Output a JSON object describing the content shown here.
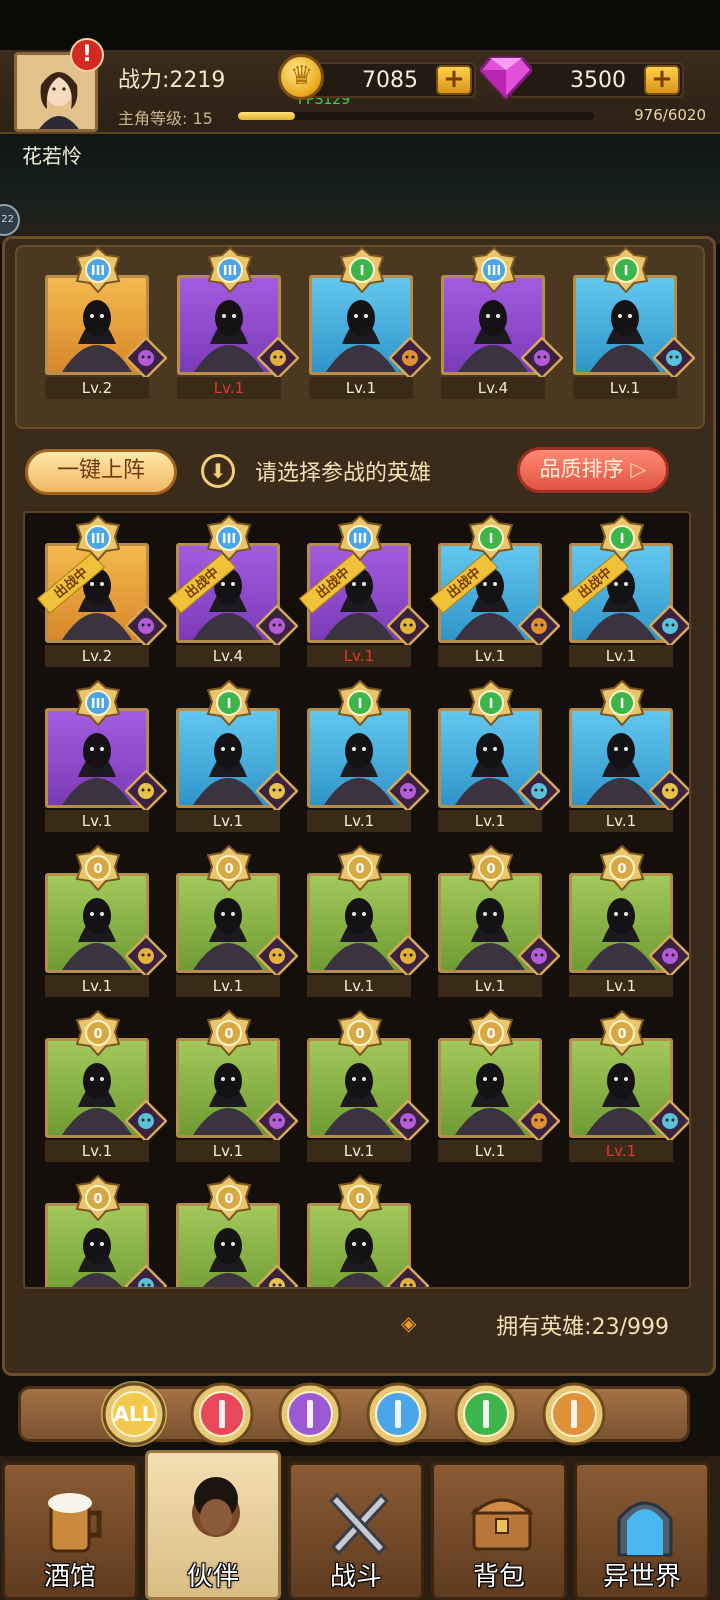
{
  "header": {
    "power_label": "战力:2219",
    "level_label": "主角等级:",
    "level_value": "15",
    "xp_value": "976",
    "xp_max": "/6020",
    "xp_fraction": 0.16,
    "fps": "FPS129",
    "gold": "7085",
    "gems": "3500",
    "player_name": "花若怜",
    "side_badge": "22"
  },
  "team": [
    {
      "rank": "III",
      "level": "Lv.2",
      "bg": "gold",
      "faction": "demon-icon"
    },
    {
      "rank": "III",
      "level": "Lv.1",
      "bg": "purple",
      "faction": "crown-icon",
      "red": true
    },
    {
      "rank": "I",
      "level": "Lv.1",
      "bg": "blue",
      "faction": "lion-icon"
    },
    {
      "rank": "III",
      "level": "Lv.4",
      "bg": "purple",
      "faction": "demon-icon"
    },
    {
      "rank": "I",
      "level": "Lv.1",
      "bg": "blue",
      "faction": "elf-icon"
    }
  ],
  "controls": {
    "one_click": "一键上阵",
    "hint": "请选择参战的英雄",
    "sort": "品质排序",
    "owned_label": "拥有英雄:",
    "owned_value": "23/999",
    "deployed_tag": "出战中"
  },
  "heroes": [
    {
      "rank": "III",
      "level": "Lv.2",
      "bg": "gold",
      "faction": "demon-icon",
      "deployed": true
    },
    {
      "rank": "III",
      "level": "Lv.4",
      "bg": "purple",
      "faction": "demon-icon",
      "deployed": true
    },
    {
      "rank": "III",
      "level": "Lv.1",
      "bg": "purple",
      "faction": "crown-icon",
      "deployed": true,
      "red": true
    },
    {
      "rank": "I",
      "level": "Lv.1",
      "bg": "blue",
      "faction": "lion-icon",
      "deployed": true
    },
    {
      "rank": "I",
      "level": "Lv.1",
      "bg": "blue",
      "faction": "elf-icon",
      "deployed": true
    },
    {
      "rank": "III",
      "level": "Lv.1",
      "bg": "purple",
      "faction": "angel-icon"
    },
    {
      "rank": "I",
      "level": "Lv.1",
      "bg": "blue",
      "faction": "angel-icon"
    },
    {
      "rank": "I",
      "level": "Lv.1",
      "bg": "blue",
      "faction": "demon-icon"
    },
    {
      "rank": "I",
      "level": "Lv.1",
      "bg": "blue",
      "faction": "elf-icon"
    },
    {
      "rank": "I",
      "level": "Lv.1",
      "bg": "blue",
      "faction": "angel-icon"
    },
    {
      "rank": "0",
      "level": "Lv.1",
      "bg": "green",
      "faction": "crown-icon"
    },
    {
      "rank": "0",
      "level": "Lv.1",
      "bg": "green",
      "faction": "crown-icon"
    },
    {
      "rank": "0",
      "level": "Lv.1",
      "bg": "green",
      "faction": "crown-icon"
    },
    {
      "rank": "0",
      "level": "Lv.1",
      "bg": "green",
      "faction": "demon-icon"
    },
    {
      "rank": "0",
      "level": "Lv.1",
      "bg": "green",
      "faction": "demon-icon"
    },
    {
      "rank": "0",
      "level": "Lv.1",
      "bg": "green",
      "faction": "elf-icon"
    },
    {
      "rank": "0",
      "level": "Lv.1",
      "bg": "green",
      "faction": "demon-icon"
    },
    {
      "rank": "0",
      "level": "Lv.1",
      "bg": "green",
      "faction": "demon-icon"
    },
    {
      "rank": "0",
      "level": "Lv.1",
      "bg": "green",
      "faction": "lion-icon"
    },
    {
      "rank": "0",
      "level": "Lv.1",
      "bg": "green",
      "faction": "elf-icon",
      "red": true
    },
    {
      "rank": "0",
      "level": "",
      "bg": "green",
      "faction": "elf-icon"
    },
    {
      "rank": "0",
      "level": "",
      "bg": "green",
      "faction": "angel-icon"
    },
    {
      "rank": "0",
      "level": "",
      "bg": "green",
      "faction": "crown-icon"
    }
  ],
  "filters": [
    {
      "label": "ALL",
      "icon": "all-filter-icon",
      "color": "#f2c94c"
    },
    {
      "label": "",
      "icon": "sword-class-icon",
      "color": "#e8485a"
    },
    {
      "label": "",
      "icon": "staff-class-icon",
      "color": "#9b59d6"
    },
    {
      "label": "",
      "icon": "dagger-class-icon",
      "color": "#4aa6e8"
    },
    {
      "label": "",
      "icon": "heal-class-icon",
      "color": "#3cb64a"
    },
    {
      "label": "",
      "icon": "shield-class-icon",
      "color": "#e0913a"
    }
  ],
  "nav": [
    {
      "label": "酒馆",
      "icon": "beer-mug-icon"
    },
    {
      "label": "伙伴",
      "icon": "partner-face-icon",
      "active": true
    },
    {
      "label": "战斗",
      "icon": "crossed-swords-icon"
    },
    {
      "label": "背包",
      "icon": "treasure-chest-icon"
    },
    {
      "label": "异世界",
      "icon": "portal-icon"
    }
  ],
  "colors": {
    "gold": "#f4b94e",
    "purple": "#a25ce0",
    "blue": "#63c8ef",
    "green": "#a2c95a",
    "rank_green": "#3cb64a",
    "rank_blue": "#4aa6e8",
    "rank_gold": "#d8a842"
  }
}
